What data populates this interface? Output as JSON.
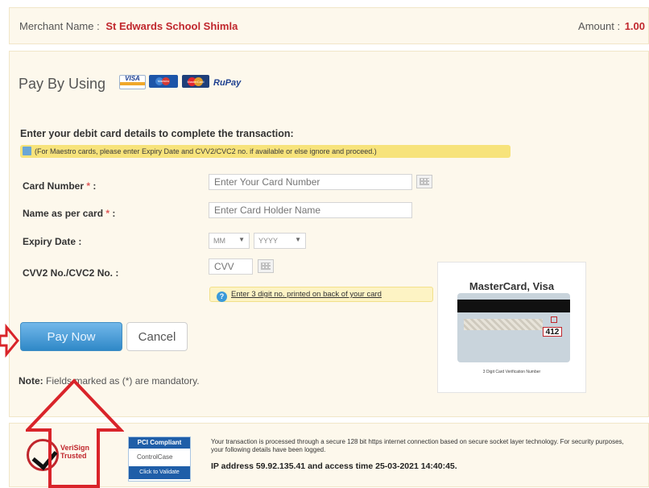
{
  "merchant": {
    "label": "Merchant Name :",
    "name": "St Edwards School Shimla",
    "amount_label": "Amount :",
    "amount": "1.00"
  },
  "pay_by": {
    "label": "Pay By Using",
    "logos": [
      "VISA",
      "Maestro",
      "MasterCard",
      "RuPay"
    ]
  },
  "form": {
    "instruction": "Enter your debit card details to complete the transaction:",
    "maestro_note": "(For Maestro cards, please enter Expiry Date and CVV2/CVC2 no. if available or else ignore and proceed.)",
    "card_number": {
      "label": "Card Number",
      "required": "*",
      "suffix": ":",
      "placeholder": "Enter Your Card Number"
    },
    "name": {
      "label": "Name as per card",
      "required": "*",
      "suffix": ":",
      "placeholder": "Enter Card Holder Name"
    },
    "expiry": {
      "label": "Expiry Date :",
      "month": "MM",
      "year": "YYYY"
    },
    "cvv": {
      "label": "CVV2 No./CVC2 No. :",
      "placeholder": "CVV"
    },
    "cvv_tip": "Enter 3 digit no. printed on back of your card"
  },
  "card_image": {
    "title": "MasterCard, Visa",
    "cvv_sample": "412",
    "caption": "3 Digit Card Verification Number"
  },
  "buttons": {
    "pay_now": "Pay Now",
    "cancel": "Cancel"
  },
  "note": {
    "prefix": "Note:",
    "text": "Fields marked as (*) are mandatory."
  },
  "footer": {
    "verisign": "VeriSign Trusted",
    "pci_top": "PCI Compliant",
    "pci_mid": "ControlCase",
    "pci_bottom": "Click to Validate",
    "secure_text": "Your transaction is processed through a secure 128 bit https internet connection based on secure socket layer technology. For security purposes, your following details have been logged.",
    "ip_text": "IP address 59.92.135.41 and access time 25-03-2021 14:40:45."
  },
  "colors": {
    "accent_red": "#c0272d",
    "button_blue": "#2f88c7",
    "panel_bg": "#fdf8ec",
    "note_yellow": "#f7e37b",
    "arrow": "#d9242a"
  }
}
